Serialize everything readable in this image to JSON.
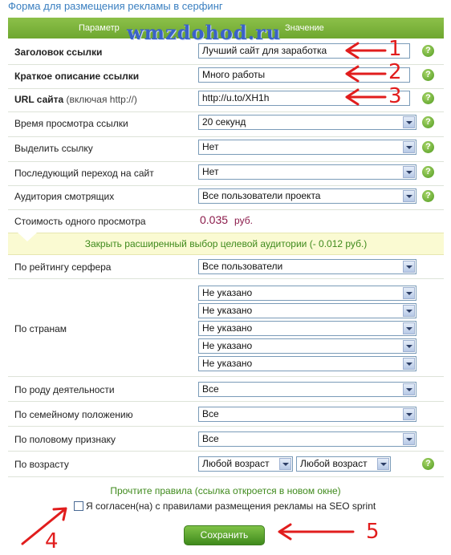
{
  "form_title": "Форма для размещения рекламы в серфинг",
  "header": {
    "param": "Параметр",
    "value": "Значение",
    "watermark": "wmzdohod.ru"
  },
  "fields": {
    "title_label": "Заголовок ссылки",
    "title_value": "Лучший сайт для заработка",
    "desc_label": "Краткое описание ссылки",
    "desc_value": "Много работы",
    "url_label": "URL сайта",
    "url_hint": "(включая http://)",
    "url_value": "http://u.to/XH1h",
    "view_time_label": "Время просмотра ссылки",
    "view_time_value": "20 секунд",
    "highlight_label": "Выделить ссылку",
    "highlight_value": "Нет",
    "followup_label": "Последующий переход на сайт",
    "followup_value": "Нет",
    "audience_label": "Аудитория смотрящих",
    "audience_value": "Все пользователи проекта",
    "cost_label": "Стоимость одного просмотра",
    "cost_value": "0.035",
    "cost_unit": "руб."
  },
  "targeting_band": "Закрыть расширенный выбор целевой аудитории  (- 0.012 руб.)",
  "targeting": {
    "rating_label": "По рейтингу серфера",
    "rating_value": "Все пользователи",
    "countries_label": "По странам",
    "countries": [
      "Не указано",
      "Не указано",
      "Не указано",
      "Не указано",
      "Не указано"
    ],
    "activity_label": "По роду деятельности",
    "activity_value": "Все",
    "family_label": "По семейному положению",
    "family_value": "Все",
    "gender_label": "По половому признаку",
    "gender_value": "Все",
    "age_label": "По возрасту",
    "age_from": "Любой возраст",
    "age_to": "Любой возраст"
  },
  "rules_link": "Прочтите правила (ссылка откроется в новом окне)",
  "agree_text": "Я согласен(на) с правилами размещения рекламы на SEO sprint",
  "save_label": "Сохранить",
  "help_glyph": "?",
  "annotations": [
    "1",
    "2",
    "3",
    "4",
    "5"
  ],
  "colors": {
    "accent_green": "#6ea72f",
    "link_green": "#3f8a1c",
    "arrow_red": "#e11d1d",
    "cost": "#8b1a4a"
  }
}
